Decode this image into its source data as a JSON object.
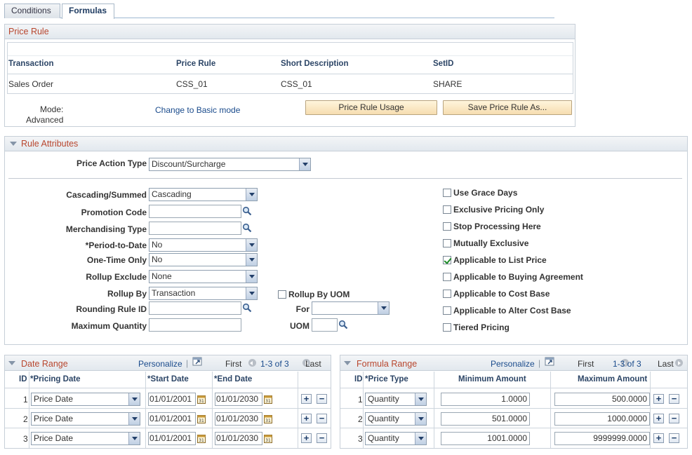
{
  "tabs": [
    {
      "label": "Conditions"
    },
    {
      "label": "Formulas"
    }
  ],
  "price_rule": {
    "title": "Price Rule",
    "columns": [
      "Transaction",
      "Price Rule",
      "Short Description",
      "SetID"
    ],
    "row": [
      "Sales Order",
      "CSS_01",
      "CSS_01",
      "SHARE"
    ],
    "mode_label": "Mode:",
    "mode_value": "Advanced",
    "change_mode_link": "Change to Basic mode",
    "usage_button": "Price Rule Usage",
    "save_as_button": "Save Price Rule As..."
  },
  "rule_attributes": {
    "title": "Rule Attributes",
    "price_action_type": {
      "label": "Price Action Type",
      "value": "Discount/Surcharge"
    },
    "cascading": {
      "label": "Cascading/Summed",
      "value": "Cascading"
    },
    "promotion_code": {
      "label": "Promotion Code",
      "value": ""
    },
    "merch_type": {
      "label": "Merchandising Type",
      "value": ""
    },
    "period_to_date": {
      "label": "*Period-to-Date",
      "value": "No"
    },
    "one_time_only": {
      "label": "One-Time Only",
      "value": "No"
    },
    "rollup_exclude": {
      "label": "Rollup Exclude",
      "value": "None"
    },
    "rollup_by": {
      "label": "Rollup By",
      "value": "Transaction"
    },
    "rollup_by_uom": {
      "label": "Rollup By UOM"
    },
    "rounding_rule": {
      "label": "Rounding Rule ID",
      "value": ""
    },
    "for": {
      "label": "For",
      "value": ""
    },
    "max_qty": {
      "label": "Maximum Quantity",
      "value": ""
    },
    "uom": {
      "label": "UOM",
      "value": ""
    },
    "checkboxes": [
      {
        "label": "Use Grace Days",
        "checked": false
      },
      {
        "label": "Exclusive Pricing Only",
        "checked": false
      },
      {
        "label": "Stop Processing Here",
        "checked": false
      },
      {
        "label": "Mutually Exclusive",
        "checked": false
      },
      {
        "label": "Applicable to List Price",
        "checked": true
      },
      {
        "label": "Applicable to Buying Agreement",
        "checked": false
      },
      {
        "label": "Applicable to Cost Base",
        "checked": false
      },
      {
        "label": "Applicable to Alter Cost Base",
        "checked": false
      },
      {
        "label": "Tiered Pricing",
        "checked": false
      }
    ]
  },
  "date_range": {
    "title": "Date Range",
    "personalize": "Personalize",
    "first": "First",
    "range": "1-3 of 3",
    "last": "Last",
    "columns": [
      "ID",
      "*Pricing Date",
      "*Start Date",
      "*End Date"
    ],
    "rows": [
      {
        "id": "1",
        "pricing_date": "Price Date",
        "start": "01/01/2001",
        "end": "01/01/2030"
      },
      {
        "id": "2",
        "pricing_date": "Price Date",
        "start": "01/01/2001",
        "end": "01/01/2030"
      },
      {
        "id": "3",
        "pricing_date": "Price Date",
        "start": "01/01/2001",
        "end": "01/01/2030"
      }
    ]
  },
  "formula_range": {
    "title": "Formula Range",
    "personalize": "Personalize",
    "first": "First",
    "range": "1-3 of 3",
    "last": "Last",
    "columns": [
      "ID",
      "*Price Type",
      "Minimum Amount",
      "Maximum Amount"
    ],
    "rows": [
      {
        "id": "1",
        "price_type": "Quantity",
        "min": "1.0000",
        "max": "500.0000"
      },
      {
        "id": "2",
        "price_type": "Quantity",
        "min": "501.0000",
        "max": "1000.0000"
      },
      {
        "id": "3",
        "price_type": "Quantity",
        "min": "1001.0000",
        "max": "9999999.0000"
      }
    ]
  },
  "icons": {
    "lookup": "magnifier-icon",
    "calendar": "calendar-icon",
    "add": "plus-icon",
    "delete": "minus-icon",
    "collapse": "collapse-triangle-icon",
    "grid_view": "view-all-icon"
  },
  "colors": {
    "section_title": "#b8462e",
    "link": "#1a4b8c",
    "button": "#f6ddb0"
  }
}
